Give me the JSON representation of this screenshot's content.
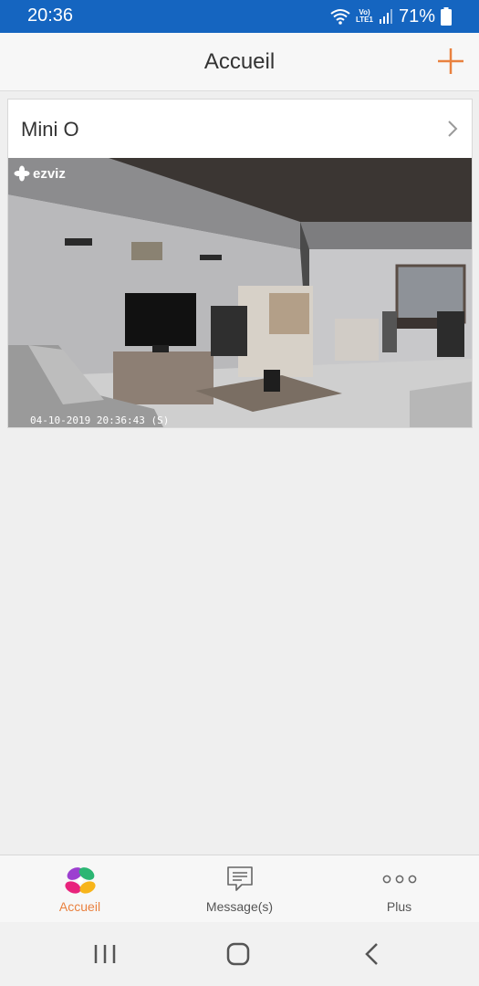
{
  "status_bar": {
    "time": "20:36",
    "signal_label_top": "Vo)",
    "signal_label_bottom": "LTE1",
    "battery": "71%"
  },
  "header": {
    "title": "Accueil",
    "add_icon": "plus-icon",
    "accent_color": "#e9813f"
  },
  "device": {
    "name": "Mini O",
    "preview": {
      "brand": "ezviz",
      "timestamp": "04-10-2019 20:36:43  (S)"
    }
  },
  "tabs": [
    {
      "label": "Accueil",
      "icon": "ezviz-logo-icon",
      "active": true
    },
    {
      "label": "Message(s)",
      "icon": "message-icon",
      "active": false
    },
    {
      "label": "Plus",
      "icon": "more-dots-icon",
      "active": false
    }
  ],
  "system_nav": [
    "recent-apps-icon",
    "home-icon",
    "back-icon"
  ]
}
